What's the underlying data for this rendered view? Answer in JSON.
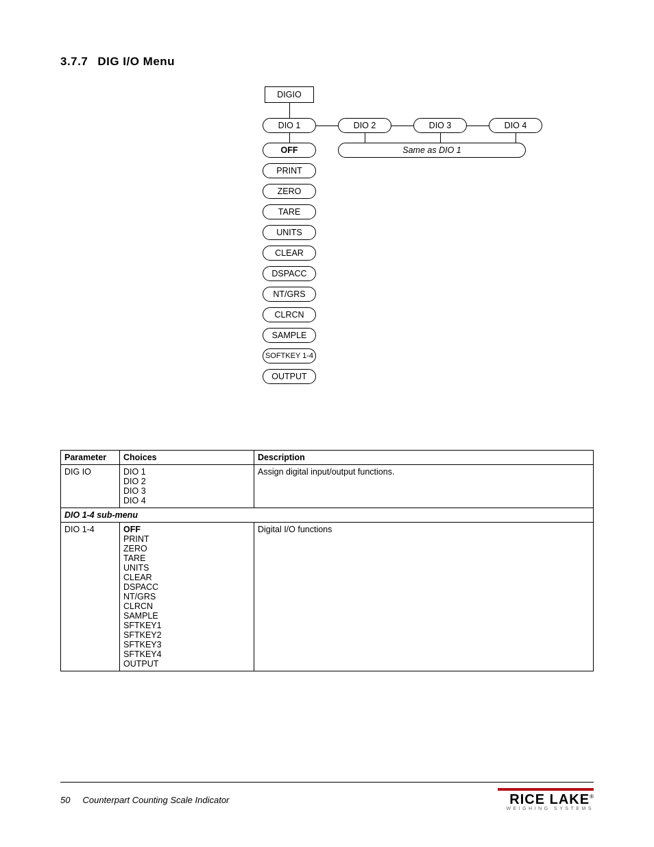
{
  "heading": {
    "num": "3.7.7",
    "title": "DIG I/O Menu"
  },
  "diagram": {
    "root": "DIGIO",
    "top_row": [
      "DIO 1",
      "DIO 2",
      "DIO 3",
      "DIO 4"
    ],
    "options": [
      "OFF",
      "PRINT",
      "ZERO",
      "TARE",
      "UNITS",
      "CLEAR",
      "DSPACC",
      "NT/GRS",
      "CLRCN",
      "SAMPLE",
      "SOFTKEY 1-4",
      "OUTPUT"
    ],
    "same_as": "Same as DIO 1"
  },
  "table": {
    "headers": [
      "Parameter",
      "Choices",
      "Description"
    ],
    "rows": [
      {
        "param": "DIG IO",
        "choices": [
          "DIO 1",
          "DIO 2",
          "DIO 3",
          "DIO 4"
        ],
        "desc": "Assign digital input/output functions."
      }
    ],
    "sub_header": "DIO 1-4 sub-menu",
    "sub_rows": [
      {
        "param": "DIO 1-4",
        "choices": [
          "OFF",
          "PRINT",
          "ZERO",
          "TARE",
          "UNITS",
          "CLEAR",
          "DSPACC",
          "NT/GRS",
          "CLRCN",
          "SAMPLE",
          "SFTKEY1",
          "SFTKEY2",
          "SFTKEY3",
          "SFTKEY4",
          "OUTPUT"
        ],
        "desc": "Digital I/O functions"
      }
    ]
  },
  "footer": {
    "page": "50",
    "doc": "Counterpart Counting Scale Indicator",
    "logo_main": "RICE LAKE",
    "logo_sub": "WEIGHING SYSTEMS"
  }
}
